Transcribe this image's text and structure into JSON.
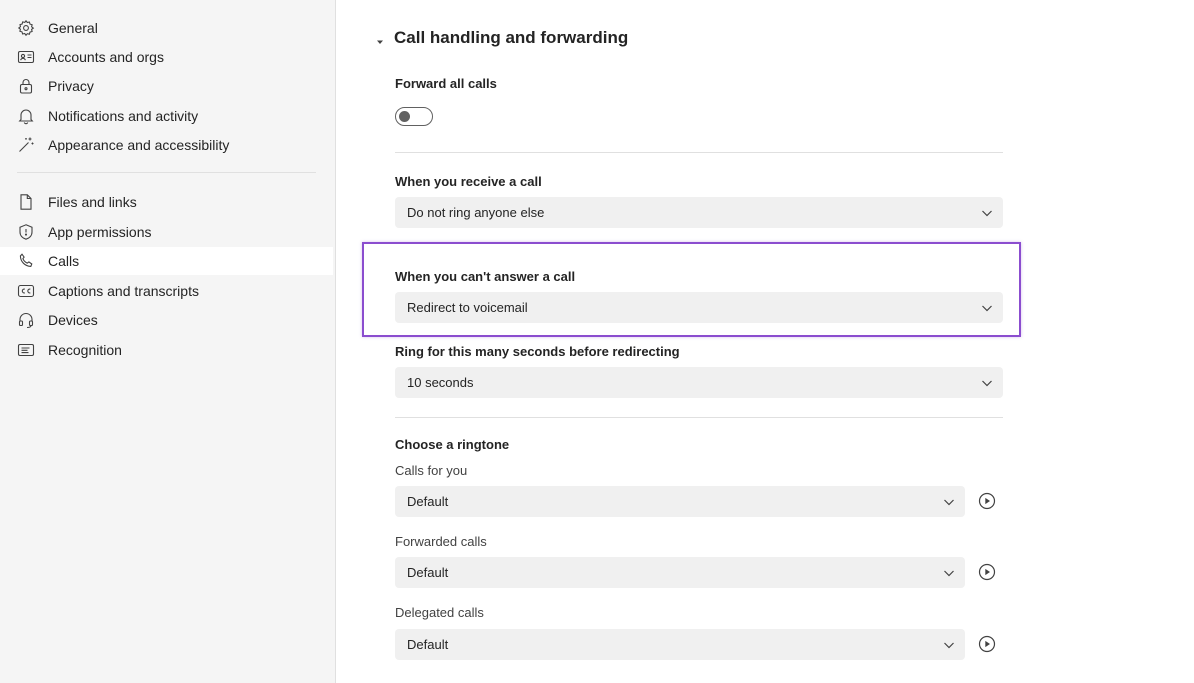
{
  "sidebar": {
    "items": [
      {
        "label": "General",
        "icon": "gear-icon"
      },
      {
        "label": "Accounts and orgs",
        "icon": "id-card-icon"
      },
      {
        "label": "Privacy",
        "icon": "lock-icon"
      },
      {
        "label": "Notifications and activity",
        "icon": "bell-icon"
      },
      {
        "label": "Appearance and accessibility",
        "icon": "magic-wand-icon"
      },
      {
        "label": "Files and links",
        "icon": "document-icon"
      },
      {
        "label": "App permissions",
        "icon": "shield-icon"
      },
      {
        "label": "Calls",
        "icon": "phone-icon",
        "selected": true
      },
      {
        "label": "Captions and transcripts",
        "icon": "closed-caption-icon"
      },
      {
        "label": "Devices",
        "icon": "headset-icon"
      },
      {
        "label": "Recognition",
        "icon": "recognition-icon"
      }
    ]
  },
  "section": {
    "title": "Call handling and forwarding"
  },
  "forward_all": {
    "label": "Forward all calls",
    "enabled": false
  },
  "receive_call": {
    "label": "When you receive a call",
    "value": "Do not ring anyone else"
  },
  "cant_answer": {
    "label": "When you can't answer a call",
    "value": "Redirect to voicemail"
  },
  "ring_seconds": {
    "label": "Ring for this many seconds before redirecting",
    "value": "10 seconds"
  },
  "ringtone": {
    "label": "Choose a ringtone",
    "items": [
      {
        "label": "Calls for you",
        "value": "Default"
      },
      {
        "label": "Forwarded calls",
        "value": "Default"
      },
      {
        "label": "Delegated calls",
        "value": "Default"
      }
    ]
  },
  "colors": {
    "highlight": "#8b4dcf",
    "sidebar_bg": "#f5f5f5",
    "dropdown_bg": "#f0f0f0"
  }
}
